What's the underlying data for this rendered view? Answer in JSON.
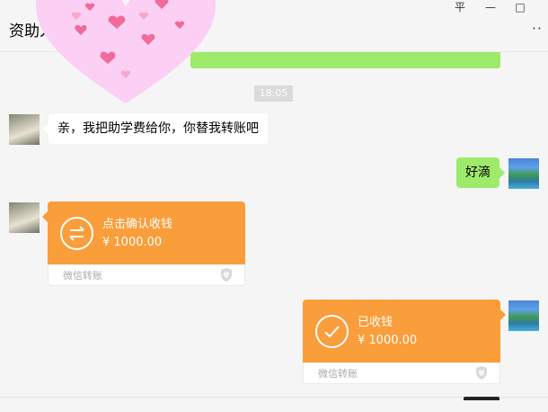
{
  "window": {
    "title": "资助人",
    "more_label": "··",
    "pin_label": "平",
    "minimize_label": "—",
    "maximize_label": "□"
  },
  "chat": {
    "timestamp": "18:05",
    "messages": [
      {
        "side": "left",
        "text": "亲，我把助学费给你，你替我转账吧"
      },
      {
        "side": "right",
        "text": "好滴"
      }
    ],
    "transfers": [
      {
        "side": "left",
        "title": "点击确认收钱",
        "amount": "¥ 1000.00",
        "footer": "微信转账",
        "icon": "transfer-arrows-icon"
      },
      {
        "side": "right",
        "title": "已收钱",
        "amount": "¥ 1000.00",
        "footer": "微信转账",
        "icon": "check-icon"
      }
    ]
  },
  "colors": {
    "sent_bubble": "#9eea6a",
    "transfer": "#fa9d3b",
    "background": "#f5f5f5"
  }
}
